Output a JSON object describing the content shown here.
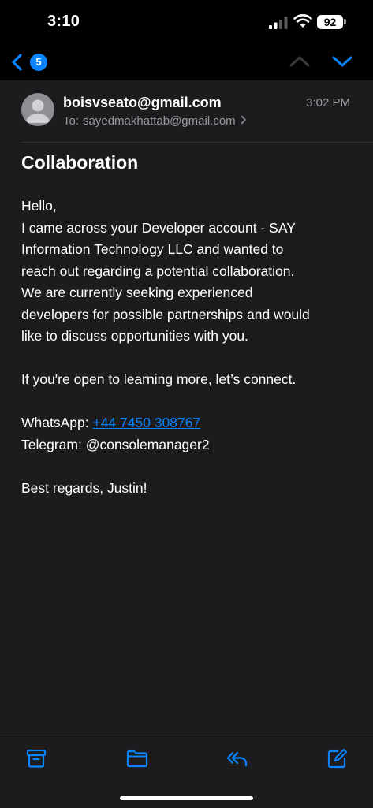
{
  "status_bar": {
    "time": "3:10",
    "battery": "92"
  },
  "nav": {
    "unread_count": "5"
  },
  "email": {
    "sender": "boisvseato@gmail.com",
    "time": "3:02 PM",
    "to_label": "To:",
    "to_address": "sayedmakhattab@gmail.com",
    "subject": "Collaboration",
    "body": {
      "greeting": "Hello,",
      "paragraph1_lines": [
        "I came across your Developer account - SAY",
        "Information Technology LLC and wanted to",
        "reach out regarding a potential collaboration.",
        "We are currently seeking experienced",
        "developers for possible partnerships and would",
        "like to discuss opportunities with you."
      ],
      "paragraph2": "If you're open to learning more, let’s connect.",
      "whatsapp_label": "WhatsApp:",
      "whatsapp_number": "+44 7450 308767",
      "telegram": "Telegram: @consolemanager2",
      "signoff": "Best regards, Justin!"
    }
  },
  "icons": {
    "back": "chevron-left-icon",
    "up": "chevron-up-icon",
    "down": "chevron-down-icon",
    "archive": "archive-icon",
    "folder": "folder-icon",
    "reply": "reply-icon",
    "compose": "compose-icon"
  },
  "colors": {
    "accent": "#0a84ff",
    "background": "#1c1c1e",
    "secondary_text": "#98989d"
  }
}
